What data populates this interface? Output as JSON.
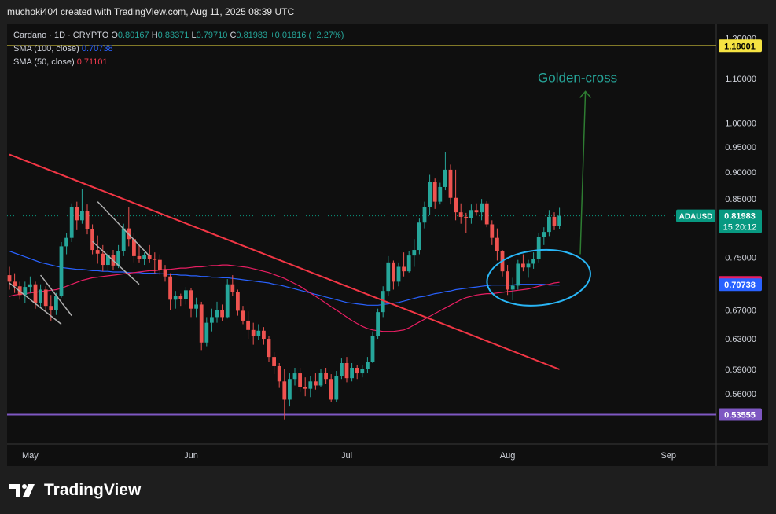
{
  "header": {
    "text": "muchoki404 created with TradingView.com, Aug 11, 2025 08:39 UTC"
  },
  "legend": {
    "symbol": "Cardano · 1D · CRYPTO",
    "o_label": "O",
    "o_value": "0.80167",
    "h_label": "H",
    "h_value": "0.83371",
    "l_label": "L",
    "l_value": "0.79710",
    "c_label": "C",
    "c_value": "0.81983",
    "change": "+0.01816 (+2.27%)",
    "sma100_label": "SMA (100, close)",
    "sma100_value": "0.70738",
    "sma50_label": "SMA (50, close)",
    "sma50_value": "0.71101"
  },
  "annotation": {
    "golden_cross": "Golden-cross"
  },
  "footer": {
    "brand": "TradingView"
  },
  "colors": {
    "up": "#26a69a",
    "down": "#ef5350",
    "sma100": "#2962ff",
    "sma50": "#e91e63",
    "trendline": "#f23645",
    "resistance": "#f5e342",
    "support": "#7e57c2",
    "annotation": "#2e7d32",
    "circle": "#29b6f6",
    "price_label": "#089981"
  },
  "chart_data": {
    "type": "candlestick",
    "symbol": "ADAUSD",
    "timeframe": "1D",
    "y_scale": "log",
    "price_ticks": [
      "1.20000",
      "1.10000",
      "1.00000",
      "0.95000",
      "0.90000",
      "0.85000",
      "0.75000",
      "0.67000",
      "0.63000",
      "0.59000",
      "0.56000"
    ],
    "x_ticks": [
      "May",
      "Jun",
      "Jul",
      "Aug",
      "Sep"
    ],
    "start_date": "2025-04-27",
    "candles": [
      [
        0.722,
        0.735,
        0.7,
        0.712
      ],
      [
        0.712,
        0.725,
        0.695,
        0.705
      ],
      [
        0.705,
        0.712,
        0.685,
        0.692
      ],
      [
        0.692,
        0.712,
        0.68,
        0.704
      ],
      [
        0.704,
        0.72,
        0.695,
        0.708
      ],
      [
        0.708,
        0.712,
        0.672,
        0.68
      ],
      [
        0.68,
        0.708,
        0.675,
        0.7
      ],
      [
        0.7,
        0.705,
        0.668,
        0.676
      ],
      [
        0.676,
        0.692,
        0.655,
        0.67
      ],
      [
        0.67,
        0.695,
        0.663,
        0.69
      ],
      [
        0.69,
        0.775,
        0.688,
        0.768
      ],
      [
        0.768,
        0.79,
        0.755,
        0.782
      ],
      [
        0.782,
        0.842,
        0.775,
        0.835
      ],
      [
        0.835,
        0.845,
        0.795,
        0.812
      ],
      [
        0.812,
        0.868,
        0.806,
        0.829
      ],
      [
        0.829,
        0.84,
        0.788,
        0.797
      ],
      [
        0.797,
        0.805,
        0.755,
        0.762
      ],
      [
        0.762,
        0.786,
        0.74,
        0.756
      ],
      [
        0.756,
        0.77,
        0.728,
        0.738
      ],
      [
        0.738,
        0.76,
        0.728,
        0.754
      ],
      [
        0.754,
        0.762,
        0.73,
        0.737
      ],
      [
        0.737,
        0.77,
        0.733,
        0.76
      ],
      [
        0.76,
        0.806,
        0.752,
        0.798
      ],
      [
        0.798,
        0.836,
        0.768,
        0.78
      ],
      [
        0.78,
        0.79,
        0.742,
        0.752
      ],
      [
        0.752,
        0.77,
        0.742,
        0.748
      ],
      [
        0.748,
        0.758,
        0.738,
        0.754
      ],
      [
        0.754,
        0.77,
        0.742,
        0.748
      ],
      [
        0.748,
        0.758,
        0.725,
        0.746
      ],
      [
        0.746,
        0.755,
        0.722,
        0.73
      ],
      [
        0.73,
        0.738,
        0.712,
        0.72
      ],
      [
        0.72,
        0.725,
        0.67,
        0.685
      ],
      [
        0.685,
        0.698,
        0.672,
        0.69
      ],
      [
        0.69,
        0.694,
        0.676,
        0.686
      ],
      [
        0.686,
        0.704,
        0.678,
        0.699
      ],
      [
        0.699,
        0.702,
        0.66,
        0.672
      ],
      [
        0.672,
        0.688,
        0.66,
        0.678
      ],
      [
        0.678,
        0.682,
        0.615,
        0.625
      ],
      [
        0.625,
        0.66,
        0.62,
        0.652
      ],
      [
        0.652,
        0.672,
        0.64,
        0.66
      ],
      [
        0.66,
        0.682,
        0.652,
        0.67
      ],
      [
        0.67,
        0.678,
        0.655,
        0.66
      ],
      [
        0.66,
        0.716,
        0.658,
        0.708
      ],
      [
        0.708,
        0.722,
        0.69,
        0.696
      ],
      [
        0.696,
        0.7,
        0.662,
        0.669
      ],
      [
        0.669,
        0.676,
        0.65,
        0.655
      ],
      [
        0.655,
        0.668,
        0.63,
        0.642
      ],
      [
        0.642,
        0.652,
        0.622,
        0.634
      ],
      [
        0.634,
        0.65,
        0.628,
        0.641
      ],
      [
        0.641,
        0.646,
        0.622,
        0.63
      ],
      [
        0.63,
        0.634,
        0.6,
        0.606
      ],
      [
        0.606,
        0.612,
        0.584,
        0.594
      ],
      [
        0.594,
        0.598,
        0.567,
        0.575
      ],
      [
        0.575,
        0.59,
        0.53,
        0.553
      ],
      [
        0.553,
        0.585,
        0.545,
        0.578
      ],
      [
        0.578,
        0.592,
        0.57,
        0.585
      ],
      [
        0.585,
        0.592,
        0.562,
        0.568
      ],
      [
        0.568,
        0.58,
        0.557,
        0.566
      ],
      [
        0.566,
        0.582,
        0.556,
        0.575
      ],
      [
        0.575,
        0.585,
        0.565,
        0.57
      ],
      [
        0.57,
        0.59,
        0.568,
        0.586
      ],
      [
        0.586,
        0.592,
        0.572,
        0.578
      ],
      [
        0.578,
        0.584,
        0.55,
        0.553
      ],
      [
        0.553,
        0.588,
        0.55,
        0.582
      ],
      [
        0.582,
        0.604,
        0.578,
        0.598
      ],
      [
        0.598,
        0.606,
        0.574,
        0.579
      ],
      [
        0.579,
        0.598,
        0.575,
        0.592
      ],
      [
        0.592,
        0.596,
        0.578,
        0.585
      ],
      [
        0.585,
        0.595,
        0.58,
        0.59
      ],
      [
        0.59,
        0.606,
        0.585,
        0.6
      ],
      [
        0.6,
        0.64,
        0.598,
        0.634
      ],
      [
        0.634,
        0.672,
        0.63,
        0.667
      ],
      [
        0.667,
        0.705,
        0.66,
        0.698
      ],
      [
        0.698,
        0.752,
        0.69,
        0.742
      ],
      [
        0.742,
        0.745,
        0.7,
        0.712
      ],
      [
        0.712,
        0.742,
        0.705,
        0.735
      ],
      [
        0.735,
        0.758,
        0.72,
        0.728
      ],
      [
        0.728,
        0.76,
        0.726,
        0.753
      ],
      [
        0.753,
        0.78,
        0.735,
        0.762
      ],
      [
        0.762,
        0.815,
        0.755,
        0.808
      ],
      [
        0.808,
        0.845,
        0.798,
        0.835
      ],
      [
        0.835,
        0.895,
        0.822,
        0.882
      ],
      [
        0.882,
        0.888,
        0.832,
        0.845
      ],
      [
        0.845,
        0.88,
        0.84,
        0.872
      ],
      [
        0.872,
        0.94,
        0.866,
        0.905
      ],
      [
        0.905,
        0.915,
        0.84,
        0.852
      ],
      [
        0.852,
        0.905,
        0.812,
        0.826
      ],
      [
        0.826,
        0.842,
        0.806,
        0.818
      ],
      [
        0.818,
        0.825,
        0.79,
        0.816
      ],
      [
        0.816,
        0.84,
        0.806,
        0.83
      ],
      [
        0.83,
        0.842,
        0.82,
        0.826
      ],
      [
        0.826,
        0.85,
        0.812,
        0.842
      ],
      [
        0.842,
        0.846,
        0.8,
        0.805
      ],
      [
        0.805,
        0.812,
        0.77,
        0.782
      ],
      [
        0.782,
        0.798,
        0.745,
        0.76
      ],
      [
        0.76,
        0.762,
        0.72,
        0.728
      ],
      [
        0.728,
        0.738,
        0.692,
        0.7
      ],
      [
        0.7,
        0.718,
        0.684,
        0.706
      ],
      [
        0.706,
        0.746,
        0.7,
        0.74
      ],
      [
        0.74,
        0.755,
        0.728,
        0.734
      ],
      [
        0.734,
        0.746,
        0.718,
        0.74
      ],
      [
        0.74,
        0.758,
        0.732,
        0.748
      ],
      [
        0.748,
        0.79,
        0.742,
        0.784
      ],
      [
        0.784,
        0.8,
        0.77,
        0.792
      ],
      [
        0.792,
        0.83,
        0.785,
        0.818
      ],
      [
        0.818,
        0.826,
        0.795,
        0.802
      ],
      [
        0.802,
        0.834,
        0.797,
        0.82
      ]
    ],
    "sma100": [
      0.76,
      0.757,
      0.754,
      0.751,
      0.748,
      0.745,
      0.742,
      0.74,
      0.738,
      0.736,
      0.734,
      0.733,
      0.732,
      0.731,
      0.731,
      0.73,
      0.729,
      0.729,
      0.728,
      0.728,
      0.727,
      0.727,
      0.727,
      0.726,
      0.726,
      0.726,
      0.725,
      0.725,
      0.725,
      0.724,
      0.724,
      0.723,
      0.723,
      0.722,
      0.722,
      0.721,
      0.721,
      0.72,
      0.72,
      0.719,
      0.719,
      0.718,
      0.718,
      0.717,
      0.716,
      0.715,
      0.714,
      0.713,
      0.712,
      0.711,
      0.71,
      0.708,
      0.707,
      0.705,
      0.703,
      0.701,
      0.699,
      0.697,
      0.695,
      0.693,
      0.691,
      0.689,
      0.687,
      0.685,
      0.683,
      0.681,
      0.68,
      0.679,
      0.678,
      0.677,
      0.677,
      0.677,
      0.678,
      0.679,
      0.68,
      0.681,
      0.683,
      0.685,
      0.687,
      0.689,
      0.69,
      0.692,
      0.694,
      0.695,
      0.697,
      0.698,
      0.7,
      0.701,
      0.702,
      0.703,
      0.704,
      0.705,
      0.706,
      0.707,
      0.707,
      0.707,
      0.707,
      0.707,
      0.708,
      0.708,
      0.708,
      0.708,
      0.708,
      0.708,
      0.707,
      0.707,
      0.707
    ],
    "sma50": [
      0.69,
      0.692,
      0.693,
      0.694,
      0.695,
      0.696,
      0.697,
      0.698,
      0.699,
      0.7,
      0.702,
      0.705,
      0.708,
      0.711,
      0.714,
      0.716,
      0.718,
      0.719,
      0.72,
      0.721,
      0.722,
      0.723,
      0.724,
      0.725,
      0.726,
      0.727,
      0.728,
      0.729,
      0.729,
      0.73,
      0.731,
      0.731,
      0.732,
      0.733,
      0.733,
      0.734,
      0.735,
      0.735,
      0.736,
      0.737,
      0.737,
      0.738,
      0.738,
      0.737,
      0.736,
      0.735,
      0.734,
      0.732,
      0.73,
      0.728,
      0.726,
      0.723,
      0.72,
      0.717,
      0.713,
      0.709,
      0.705,
      0.7,
      0.695,
      0.69,
      0.685,
      0.68,
      0.675,
      0.67,
      0.665,
      0.66,
      0.655,
      0.651,
      0.647,
      0.644,
      0.642,
      0.641,
      0.64,
      0.64,
      0.64,
      0.641,
      0.642,
      0.645,
      0.649,
      0.653,
      0.657,
      0.661,
      0.665,
      0.669,
      0.673,
      0.677,
      0.681,
      0.685,
      0.688,
      0.69,
      0.692,
      0.693,
      0.694,
      0.694,
      0.695,
      0.696,
      0.697,
      0.698,
      0.699,
      0.7,
      0.701,
      0.703,
      0.705,
      0.707,
      0.708,
      0.71,
      0.711
    ],
    "lines": {
      "trendline": [
        [
          "2025-04-27",
          0.935
        ],
        [
          "2025-08-11",
          0.59
        ]
      ],
      "resistance": 1.18001,
      "support": 0.53555,
      "current_price": 0.81983
    },
    "price_labels": [
      {
        "price": 1.18001,
        "text": "1.18001",
        "kind": "resistance"
      },
      {
        "price": 0.81983,
        "text": "0.81983",
        "symbol": "ADAUSD",
        "countdown": "15:20:12",
        "kind": "last"
      },
      {
        "price": 0.71101,
        "text": "0.71101",
        "kind": "sma50"
      },
      {
        "price": 0.70738,
        "text": "0.70738",
        "kind": "sma100"
      },
      {
        "price": 0.53555,
        "text": "0.53555",
        "kind": "support"
      }
    ],
    "annotations": {
      "arrow_text": "Golden-cross",
      "arrow_from": [
        "2025-08-15",
        0.755
      ],
      "arrow_to": [
        "2025-08-16",
        1.07
      ],
      "ellipse_center": [
        "2025-08-07",
        0.718
      ]
    }
  }
}
